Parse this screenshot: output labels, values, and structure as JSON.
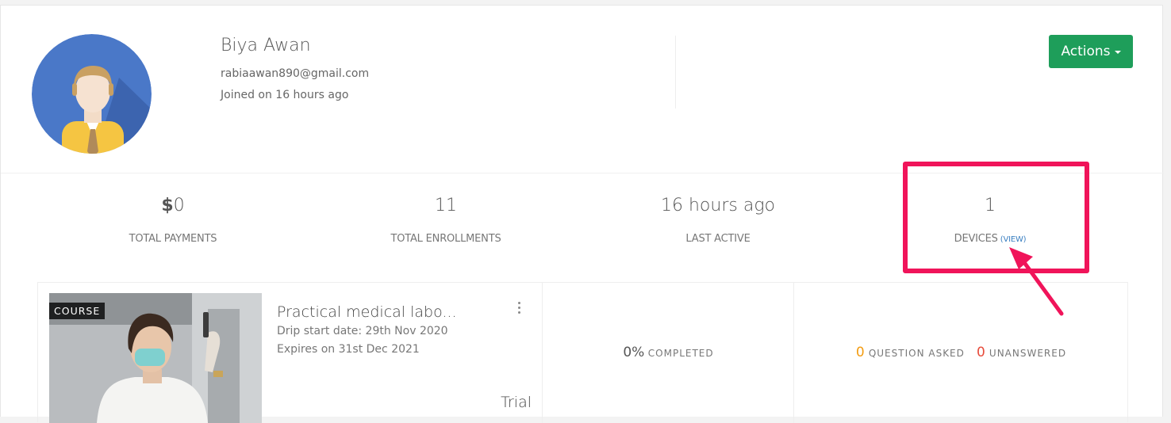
{
  "profile": {
    "name": "Biya Awan",
    "email": "rabiaawan890@gmail.com",
    "joined": "Joined on 16 hours ago",
    "avatar_icon": "user-avatar-icon"
  },
  "header": {
    "actions_label": "Actions"
  },
  "stats": {
    "payments": {
      "symbol": "$",
      "value": "0",
      "label": "TOTAL PAYMENTS"
    },
    "enrollments": {
      "value": "11",
      "label": "TOTAL ENROLLMENTS"
    },
    "last_active": {
      "value": "16 hours ago",
      "label": "LAST ACTIVE"
    },
    "devices": {
      "value": "1",
      "label": "DEVICES",
      "link": "(VIEW)"
    }
  },
  "enrollment": {
    "badge": "COURSE",
    "title": "Practical medical labo...",
    "drip": "Drip start date: 29th Nov 2020",
    "expires": "Expires on 31st Dec 2021",
    "plan": "Trial",
    "progress": {
      "value": "0%",
      "label": "COMPLETED"
    },
    "questions": {
      "asked": "0",
      "asked_label": "QUESTION ASKED",
      "unanswered": "0",
      "unanswered_label": "UNANSWERED"
    }
  },
  "colors": {
    "accent": "#1e9e5a",
    "highlight": "#f0145a",
    "link": "#3a7fc1",
    "questions": "#f39c12",
    "unanswered": "#e74c3c"
  }
}
